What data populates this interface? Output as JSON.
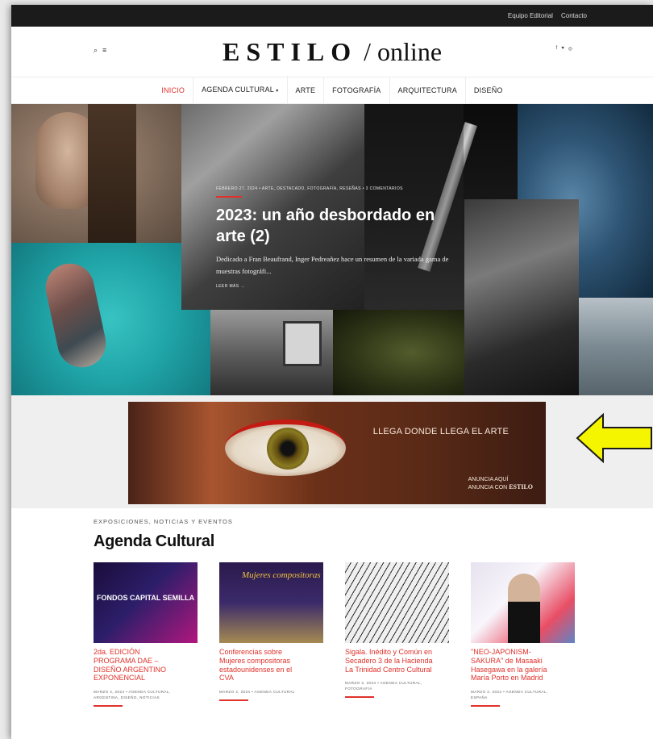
{
  "topbar": {
    "links": [
      "Equipo Editorial",
      "Contacto"
    ]
  },
  "header": {
    "logo_main": "ESTILO",
    "logo_sep": "/",
    "logo_tail": "online",
    "left_icons": [
      "search-icon",
      "menu-icon"
    ],
    "right_icons": [
      "facebook-icon",
      "twitter-icon",
      "instagram-icon"
    ]
  },
  "nav": {
    "items": [
      "INICIO",
      "AGENDA CULTURAL",
      "ARTE",
      "FOTOGRAFÍA",
      "ARQUITECTURA",
      "DISEÑO"
    ],
    "active": "INICIO"
  },
  "hero": {
    "meta": "FEBRERO 27, 2024 • ARTE, DESTACADO, FOTOGRAFÍA, RESEÑAS • 3 COMENTARIOS",
    "title": "2023: un año desbordado en arte (2)",
    "excerpt": "Dedicado a Fran Beaufrand, Inger Pedreañez hace un resumen de la variada gama de muestras fotográfi...",
    "more": "LEER MÁS →"
  },
  "banner": {
    "headline": "LLEGA DONDE LLEGA EL ARTE",
    "line1": "ANUNCIA AQUÍ",
    "line2_prefix": "ANUNCIA CON",
    "line2_brand": "ESTILO"
  },
  "agenda": {
    "kicker": "EXPOSICIONES, NOTICIAS Y EVENTOS",
    "title": "Agenda Cultural",
    "cards": [
      {
        "image_text": "FONDOS CAPITAL SEMILLA",
        "title": "2da. EDICIÓN PROGRAMA DAE – DISEÑO ARGENTINO EXPONENCIAL",
        "meta": "MARZO 4, 2024 • AGENDA CULTURAL, ARGENTINA, DISEÑO, NOTICIAS"
      },
      {
        "image_text": "Mujeres compositoras",
        "title": "Conferencias sobre Mujeres compositoras estadounidenses en el CVA",
        "meta": "MARZO 4, 2024 • AGENDA CULTURAL"
      },
      {
        "image_text": "",
        "title": "Sigala. Inédito y Común en Secadero 3 de la Hacienda La Trinidad Centro Cultural",
        "meta": "MARZO 3, 2024 • AGENDA CULTURAL, FOTOGRAFÍA"
      },
      {
        "image_text": "",
        "title": "\"NEO-JAPONISM-SAKURA\" de Masaaki Hasegawa en la galería María Porto en Madrid",
        "meta": "MARZO 2, 2024 • AGENDA CULTURAL, ESPAÑA"
      }
    ]
  },
  "colors": {
    "accent": "#e0312b",
    "topbar": "#1b1b1b",
    "arrow": "#f5f500"
  }
}
